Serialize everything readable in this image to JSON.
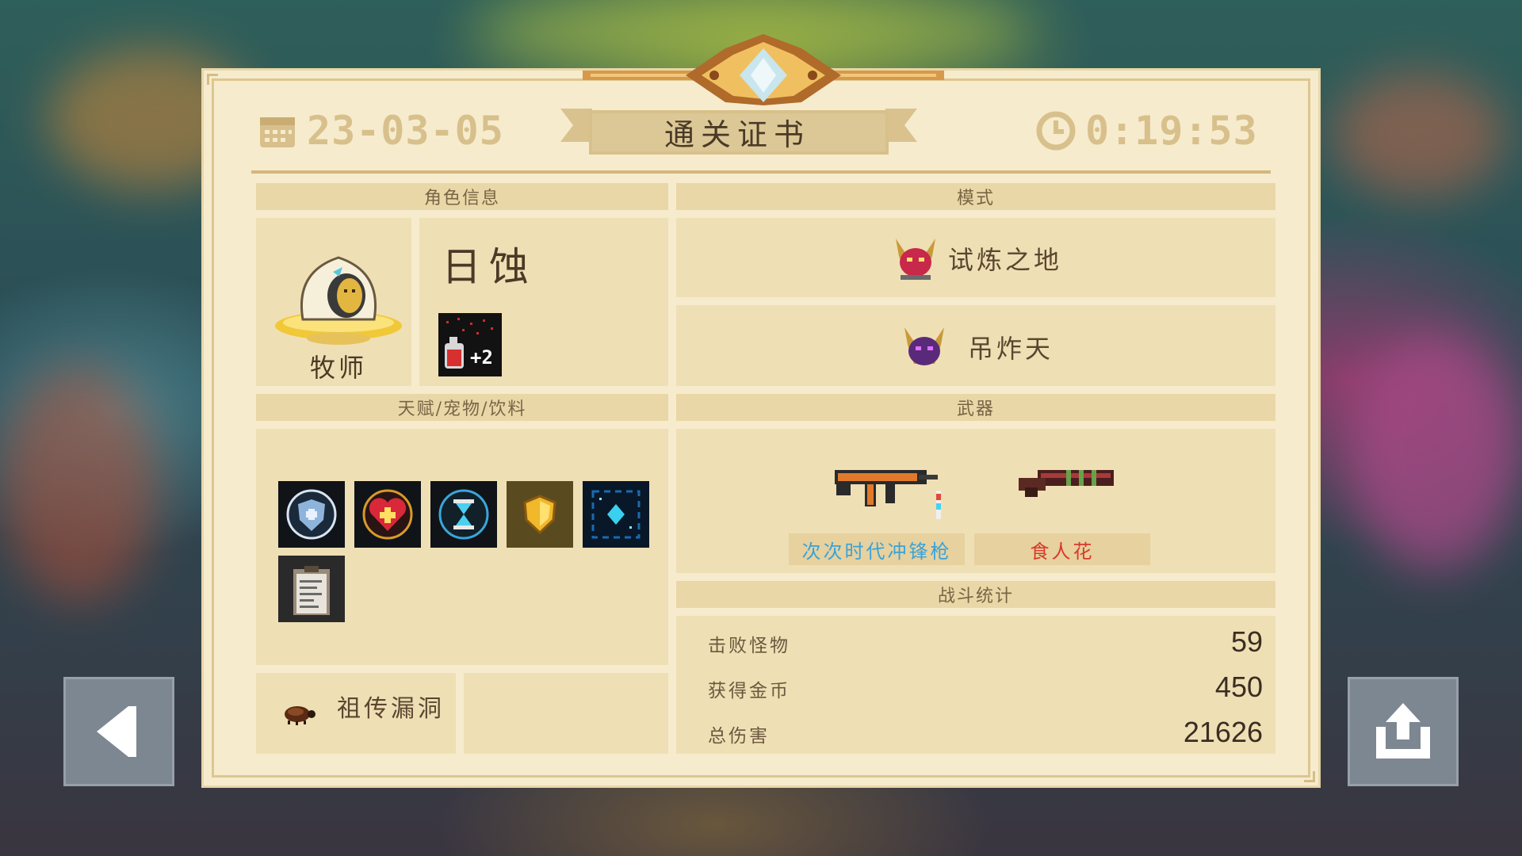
{
  "certificate": {
    "date": "23-03-05",
    "time": "0:19:53",
    "title": "通关证书"
  },
  "sections": {
    "character_info": "角色信息",
    "mode": "模式",
    "talents": "天赋/宠物/饮料",
    "weapons": "武器",
    "battle_stats": "战斗统计"
  },
  "character": {
    "class": "牧师",
    "skin_name": "日蚀",
    "potion_bonus": "+2"
  },
  "modes": [
    {
      "label": "试炼之地",
      "icon": "horned-demon-red-icon"
    },
    {
      "label": "吊炸天",
      "icon": "horned-demon-purple-icon"
    }
  ],
  "talents": [
    {
      "icon": "shield-badge-icon"
    },
    {
      "icon": "heart-plus-icon"
    },
    {
      "icon": "hourglass-icon"
    },
    {
      "icon": "gold-shield-icon"
    },
    {
      "icon": "blue-crystal-icon"
    },
    {
      "icon": "clipboard-icon"
    }
  ],
  "legacy": {
    "icon": "beetle-icon",
    "label": "祖传漏洞"
  },
  "weapons": [
    {
      "name": "次次时代冲锋枪",
      "color": "#3aa2d8",
      "icon": "smg-icon"
    },
    {
      "name": "食人花",
      "color": "#d83a2a",
      "icon": "shotgun-icon"
    }
  ],
  "stats": [
    {
      "label": "击败怪物",
      "value": "59"
    },
    {
      "label": "获得金币",
      "value": "450"
    },
    {
      "label": "总伤害",
      "value": "21626"
    }
  ],
  "buttons": {
    "back": "back-arrow-icon",
    "share": "share-icon"
  }
}
